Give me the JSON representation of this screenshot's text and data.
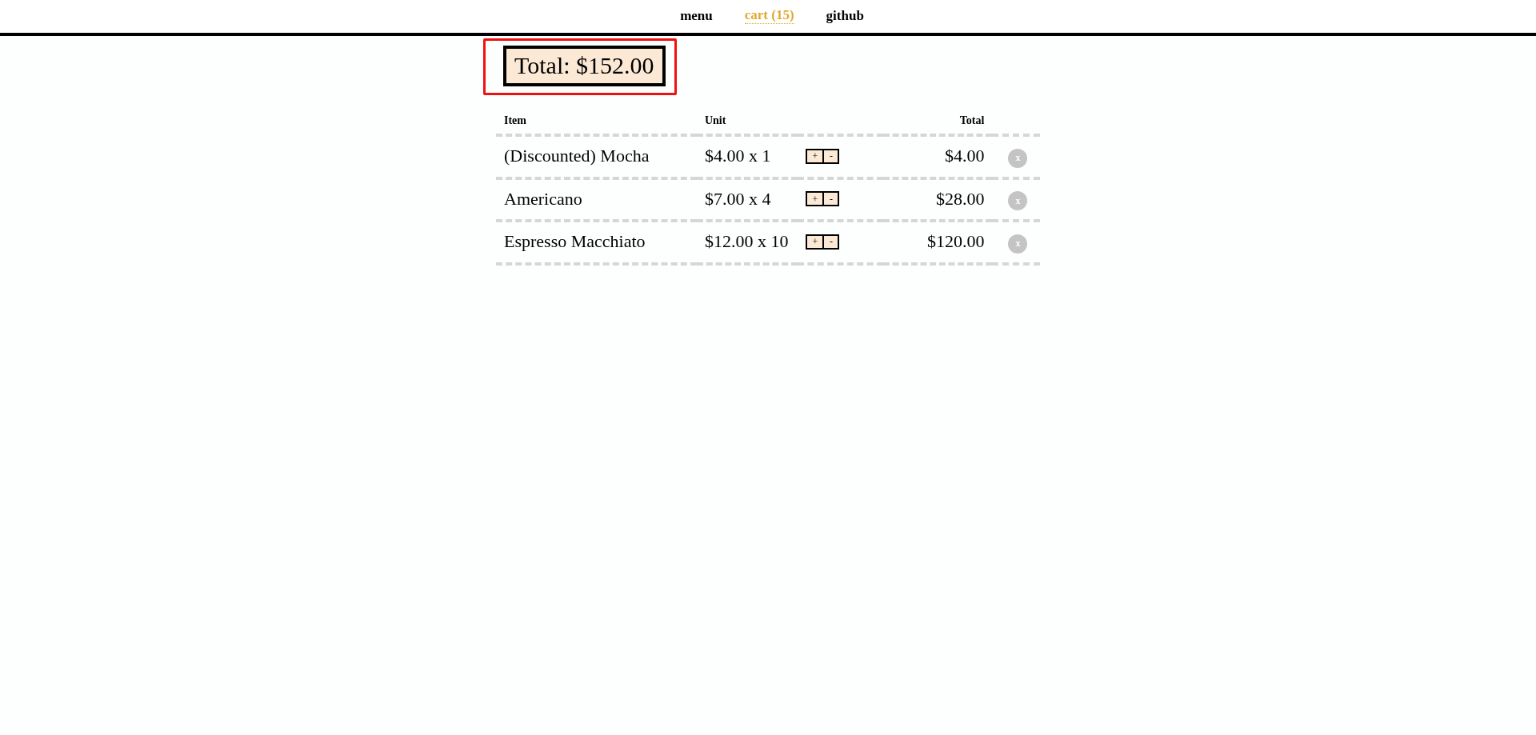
{
  "nav": [
    {
      "label": "menu",
      "selected": false
    },
    {
      "label": "cart (15)",
      "selected": true
    },
    {
      "label": "github",
      "selected": false
    }
  ],
  "total": "Total: $152.00",
  "table": {
    "columns": [
      "Item",
      "Unit",
      "Total"
    ],
    "rows": [
      {
        "item": "(Discounted) Mocha",
        "unit": "$4.00 x 1",
        "plus": "+",
        "minus": "-",
        "total": "$4.00",
        "remove": "x"
      },
      {
        "item": "Americano",
        "unit": "$7.00 x 4",
        "plus": "+",
        "minus": "-",
        "total": "$28.00",
        "remove": "x"
      },
      {
        "item": "Espresso Macchiato",
        "unit": "$12.00 x 10",
        "plus": "+",
        "minus": "-",
        "total": "$120.00",
        "remove": "x"
      }
    ]
  }
}
